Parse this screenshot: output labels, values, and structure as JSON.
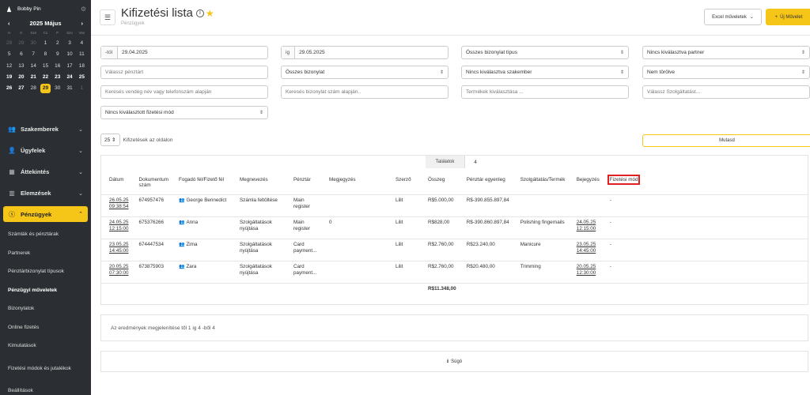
{
  "app": {
    "user_name": "Bobby Pin"
  },
  "calendar": {
    "month_label": "2025 Május",
    "day_names": [
      "H",
      "K",
      "Sze",
      "Cs",
      "P",
      "Szo",
      "Vas"
    ],
    "weeks": [
      [
        "28",
        "29",
        "30",
        "1",
        "2",
        "3",
        "4"
      ],
      [
        "5",
        "6",
        "7",
        "8",
        "9",
        "10",
        "11"
      ],
      [
        "12",
        "13",
        "14",
        "15",
        "16",
        "17",
        "18"
      ],
      [
        "19",
        "20",
        "21",
        "22",
        "23",
        "24",
        "25"
      ],
      [
        "26",
        "27",
        "28",
        "29",
        "30",
        "31",
        "1"
      ]
    ],
    "today": "29"
  },
  "nav": {
    "items": [
      {
        "label": "Szakemberek",
        "icon": "users-icon"
      },
      {
        "label": "Ügyfelek",
        "icon": "user-icon"
      },
      {
        "label": "Áttekintés",
        "icon": "grid-icon"
      },
      {
        "label": "Elemzések",
        "icon": "chart-icon"
      },
      {
        "label": "Pénzügyek",
        "icon": "money-icon"
      }
    ],
    "sub_items": [
      "Számlák és pénztárak",
      "Partnerek",
      "Pénztárbizonylat típusok",
      "Pénzügyi műveletek",
      "Bizonylatok",
      "Online fizetés",
      "Kimutatások",
      "Fizetési módok és jutalékok",
      "Beállítások"
    ]
  },
  "header": {
    "title": "Kifizetési lista",
    "breadcrumb": "Pénzügyek",
    "excel_button": "Excel műveletek",
    "new_button": "Új Művelet"
  },
  "filters": {
    "from_prefix": "-tól",
    "from_value": "29.04.2025",
    "to_prefix": "ig",
    "to_value": "29.05.2025",
    "voucher_types": "Összes bizonylat típus",
    "partner": "Nincs kiválasztva partner",
    "cash_register": "Válassz pénztárt",
    "all_vouchers": "Összes bizonylat",
    "specialist": "Nincs kiválasztva szakember",
    "not_deleted": "Nem törölve",
    "guest_search": "Keresés vendég név vagy telefonszám alapján",
    "voucher_search": "Keresés bizonylat szám alapján..",
    "products": "Termékek kiválasztása ...",
    "services": "Válassz Szolgáltatást...",
    "payment_method": "Nincs kiválasztott fizetési mód"
  },
  "list_controls": {
    "per_page_value": "25",
    "per_page_label": "Kifizetések az oldalon",
    "show_button": "Mutasd"
  },
  "results": {
    "tab_label": "Találatok",
    "count": "4",
    "columns": [
      "Dátum",
      "Dokumentum szám",
      "Fogadó fél/Fizető fél",
      "Megnevezés",
      "Pénztár",
      "Megjegyzés",
      "Szerző",
      "Összeg",
      "Pénztár egyenleg",
      "Szolgáltatás/Termék",
      "Bejegyzés",
      "Fizetési mód"
    ],
    "rows": [
      {
        "date": "26.05.25",
        "time": "09:38:54",
        "doc": "674957476",
        "party": "George Bennedict",
        "name": "Számla feltöltése",
        "register": "Main",
        "register2": "register",
        "note": "",
        "author": "Lilit",
        "amount": "R$5.000,00",
        "balance": "R$-390.855.897,84",
        "service": "",
        "entry_date": "",
        "entry_time": "",
        "payment": "-"
      },
      {
        "date": "24.05.25",
        "time": "12:15:00",
        "doc": "675376266",
        "party": "Anna",
        "name": "Szolgáltatások",
        "name2": "nyújtása",
        "register": "Main",
        "register2": "register",
        "note": "0",
        "author": "Lilit",
        "amount": "R$828,00",
        "balance": "R$-390.860.897,84",
        "service": "Polishing fingernails",
        "entry_date": "24.05.25",
        "entry_time": "12:15:00",
        "payment": "-"
      },
      {
        "date": "23.05.25",
        "time": "14:45:00",
        "doc": "674447534",
        "party": "Zima",
        "name": "Szolgáltatások",
        "name2": "nyújtása",
        "register": "Card",
        "register2": "payment...",
        "note": "",
        "author": "Lilit",
        "amount": "R$2.760,00",
        "balance": "R$23.240,00",
        "service": "Manicure",
        "entry_date": "23.05.25",
        "entry_time": "14:45:00",
        "payment": "-"
      },
      {
        "date": "20.05.25",
        "time": "07:30:00",
        "doc": "673875903",
        "party": "Zara",
        "name": "Szolgáltatások",
        "name2": "nyújtása",
        "register": "Card",
        "register2": "payment...",
        "note": "",
        "author": "Lilit",
        "amount": "R$2.760,00",
        "balance": "R$20.480,00",
        "service": "Trimming",
        "entry_date": "20.05.25",
        "entry_time": "12:30:00",
        "payment": "-"
      }
    ],
    "total": "R$11.348,00"
  },
  "footer": {
    "summary": "Az eredmények megjelenítése től 1 ig 4 -ből 4",
    "help": "Súgó"
  },
  "colors": {
    "accent": "#f5c518",
    "sidebar": "#2b2f33",
    "highlight": "#e02020"
  }
}
